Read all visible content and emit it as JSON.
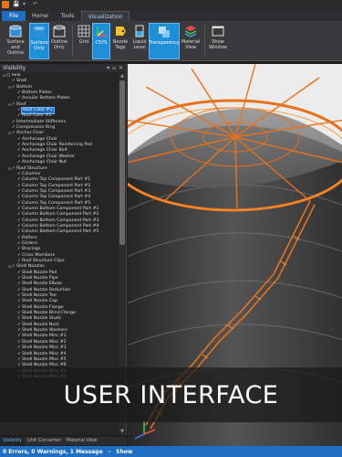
{
  "titlebar": {
    "quick_access": [
      "save-icon",
      "dropdown-icon",
      "undo-icon"
    ]
  },
  "tabs": [
    {
      "label": "File"
    },
    {
      "label": "Home"
    },
    {
      "label": "Tools"
    },
    {
      "label": "Visualization"
    }
  ],
  "ribbon": {
    "buttons": [
      {
        "label": "Surface and\nOutline",
        "icon": "surface-outline-icon"
      },
      {
        "label": "Surface\nOnly",
        "icon": "surface-only-icon",
        "selected": true
      },
      {
        "label": "Outline\nOnly",
        "icon": "outline-only-icon"
      },
      {
        "label": "Grid",
        "icon": "grid-icon"
      },
      {
        "label": "CSYS",
        "icon": "csys-icon",
        "selected": true
      },
      {
        "label": "Nozzle\nTags",
        "icon": "nozzle-tags-icon"
      },
      {
        "label": "Liquid\nLevel",
        "icon": "liquid-level-icon"
      },
      {
        "label": "Transparency",
        "icon": "transparency-icon",
        "selected": true
      },
      {
        "label": "Material\nView",
        "icon": "material-view-icon"
      },
      {
        "label": "Show\nWindow",
        "icon": "show-window-icon"
      }
    ]
  },
  "panel": {
    "title": "Visibility",
    "tree": [
      {
        "level": 0,
        "exp": "-",
        "label": "Tank",
        "checked": false
      },
      {
        "level": 1,
        "exp": "",
        "label": "Shell",
        "checked": true
      },
      {
        "level": 1,
        "exp": "-",
        "label": "Bottom",
        "checked": true
      },
      {
        "level": 2,
        "exp": "",
        "label": "Bottom Plates",
        "checked": true
      },
      {
        "level": 2,
        "exp": "",
        "label": "Annular Bottom Plates",
        "checked": true
      },
      {
        "level": 1,
        "exp": "-",
        "label": "Roof",
        "checked": true
      },
      {
        "level": 2,
        "exp": "",
        "label": "Roof Color #1",
        "checked": true,
        "highlight": true
      },
      {
        "level": 2,
        "exp": "",
        "label": "Roof Color #2",
        "checked": true
      },
      {
        "level": 1,
        "exp": "",
        "label": "Intermediate Stiffeners",
        "checked": true
      },
      {
        "level": 1,
        "exp": "",
        "label": "Compression Ring",
        "checked": true
      },
      {
        "level": 1,
        "exp": "-",
        "label": "Anchor Chair",
        "checked": true
      },
      {
        "level": 2,
        "exp": "",
        "label": "Anchorage Chair",
        "checked": true
      },
      {
        "level": 2,
        "exp": "",
        "label": "Anchorage Chair Reinforcing Pad",
        "checked": true
      },
      {
        "level": 2,
        "exp": "",
        "label": "Anchorage Chair Bolt",
        "checked": true
      },
      {
        "level": 2,
        "exp": "",
        "label": "Anchorage Chair Washer",
        "checked": true
      },
      {
        "level": 2,
        "exp": "",
        "label": "Anchorage Chair Nut",
        "checked": true
      },
      {
        "level": 1,
        "exp": "-",
        "label": "Roof Structure",
        "checked": true
      },
      {
        "level": 2,
        "exp": "",
        "label": "Columns",
        "checked": true
      },
      {
        "level": 2,
        "exp": "",
        "label": "Column Top Component Part #1",
        "checked": true
      },
      {
        "level": 2,
        "exp": "",
        "label": "Column Top Component Part #2",
        "checked": true
      },
      {
        "level": 2,
        "exp": "",
        "label": "Column Top Component Part #3",
        "checked": true
      },
      {
        "level": 2,
        "exp": "",
        "label": "Column Top Component Part #4",
        "checked": true
      },
      {
        "level": 2,
        "exp": "",
        "label": "Column Top Component Part #5",
        "checked": true
      },
      {
        "level": 2,
        "exp": "",
        "label": "Column Bottom Component Part #1",
        "checked": true
      },
      {
        "level": 2,
        "exp": "",
        "label": "Column Bottom Component Part #2",
        "checked": true
      },
      {
        "level": 2,
        "exp": "",
        "label": "Column Bottom Component Part #3",
        "checked": true
      },
      {
        "level": 2,
        "exp": "",
        "label": "Column Bottom Component Part #4",
        "checked": true
      },
      {
        "level": 2,
        "exp": "",
        "label": "Column Bottom Component Part #5",
        "checked": true
      },
      {
        "level": 2,
        "exp": "",
        "label": "Rafters",
        "checked": true
      },
      {
        "level": 2,
        "exp": "",
        "label": "Girders",
        "checked": true
      },
      {
        "level": 2,
        "exp": "",
        "label": "Bracings",
        "checked": true
      },
      {
        "level": 2,
        "exp": "",
        "label": "Cross Members",
        "checked": true
      },
      {
        "level": 2,
        "exp": "",
        "label": "Roof Structure Clips",
        "checked": true
      },
      {
        "level": 1,
        "exp": "-",
        "label": "Shell Nozzles",
        "checked": true
      },
      {
        "level": 2,
        "exp": "",
        "label": "Shell Nozzle Pad",
        "checked": true
      },
      {
        "level": 2,
        "exp": "",
        "label": "Shell Nozzle Pipe",
        "checked": true
      },
      {
        "level": 2,
        "exp": "",
        "label": "Shell Nozzle Elbow",
        "checked": true
      },
      {
        "level": 2,
        "exp": "",
        "label": "Shell Nozzle Reduction",
        "checked": true
      },
      {
        "level": 2,
        "exp": "",
        "label": "Shell Nozzle Tee",
        "checked": true
      },
      {
        "level": 2,
        "exp": "",
        "label": "Shell Nozzle Cap",
        "checked": true
      },
      {
        "level": 2,
        "exp": "",
        "label": "Shell Nozzle Flange",
        "checked": true
      },
      {
        "level": 2,
        "exp": "",
        "label": "Shell Nozzle Blind Flange",
        "checked": true
      },
      {
        "level": 2,
        "exp": "",
        "label": "Shell Nozzle Studs",
        "checked": true
      },
      {
        "level": 2,
        "exp": "",
        "label": "Shell Nozzle Nuts",
        "checked": true
      },
      {
        "level": 2,
        "exp": "",
        "label": "Shell Nozzle Washers",
        "checked": true
      },
      {
        "level": 2,
        "exp": "",
        "label": "Shell Nozzle Misc #1",
        "checked": true
      },
      {
        "level": 2,
        "exp": "",
        "label": "Shell Nozzle Misc #2",
        "checked": true
      },
      {
        "level": 2,
        "exp": "",
        "label": "Shell Nozzle Misc #3",
        "checked": true
      },
      {
        "level": 2,
        "exp": "",
        "label": "Shell Nozzle Misc #4",
        "checked": true
      },
      {
        "level": 2,
        "exp": "",
        "label": "Shell Nozzle Misc #5",
        "checked": true
      },
      {
        "level": 2,
        "exp": "",
        "label": "Shell Nozzle Misc #6",
        "checked": true
      },
      {
        "level": 2,
        "exp": "",
        "label": "Shell Nozzle Misc #7",
        "checked": true
      },
      {
        "level": 2,
        "exp": "",
        "label": "Shell Nozzle Misc #8",
        "checked": true
      }
    ],
    "tabs": [
      "Visibility",
      "Unit Converter",
      "Material View"
    ]
  },
  "banner": {
    "text": "USER INTERFACE"
  },
  "status": {
    "messages": "0 Errors, 0 Warnings, 1 Message",
    "show": "Show"
  },
  "colors": {
    "accent": "#1e6fc2",
    "steel": "#e8721c"
  }
}
